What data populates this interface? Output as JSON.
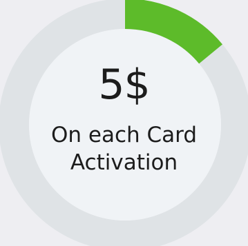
{
  "progress_widget": {
    "amount": "5$",
    "caption_line1": "On each Card",
    "caption_line2": "Activation",
    "progress_fraction": 0.14,
    "colors": {
      "track": "#dfe3e6",
      "inner": "#f0f3f6",
      "progress": "#5dbb2a",
      "text": "#1c1c1c",
      "background": "#eeeef2"
    }
  }
}
